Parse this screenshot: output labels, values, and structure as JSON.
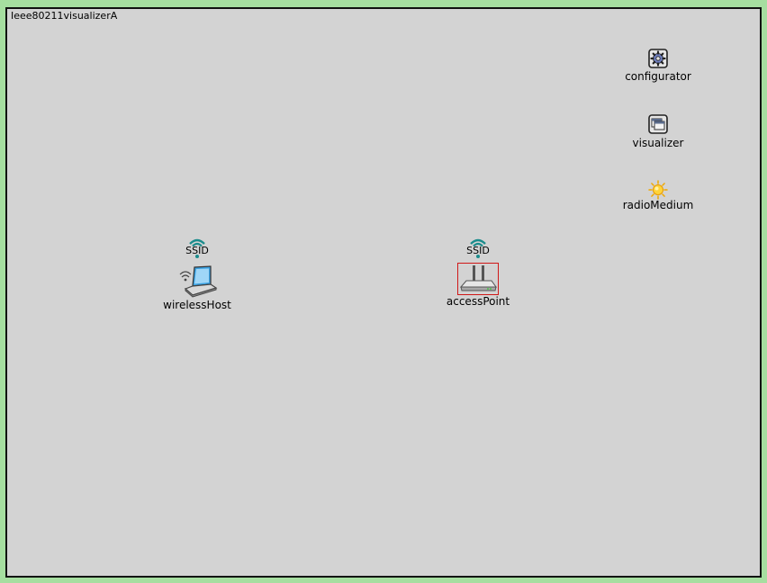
{
  "network": {
    "title": "Ieee80211visualizerA"
  },
  "nodes": {
    "configurator": {
      "label": "configurator",
      "icon": "gear-icon"
    },
    "visualizer": {
      "label": "visualizer",
      "icon": "window-icon"
    },
    "radioMedium": {
      "label": "radioMedium",
      "icon": "sun-icon"
    },
    "wirelessHost": {
      "label": "wirelessHost",
      "icon": "laptop-icon",
      "ssid": "SSID"
    },
    "accessPoint": {
      "label": "accessPoint",
      "icon": "router-icon",
      "ssid": "SSID",
      "selected": true
    }
  },
  "colors": {
    "background": "#a6dea0",
    "canvas": "#d3d3d3",
    "ssid_wave": "#1a8c8c",
    "selection": "#d01818"
  }
}
